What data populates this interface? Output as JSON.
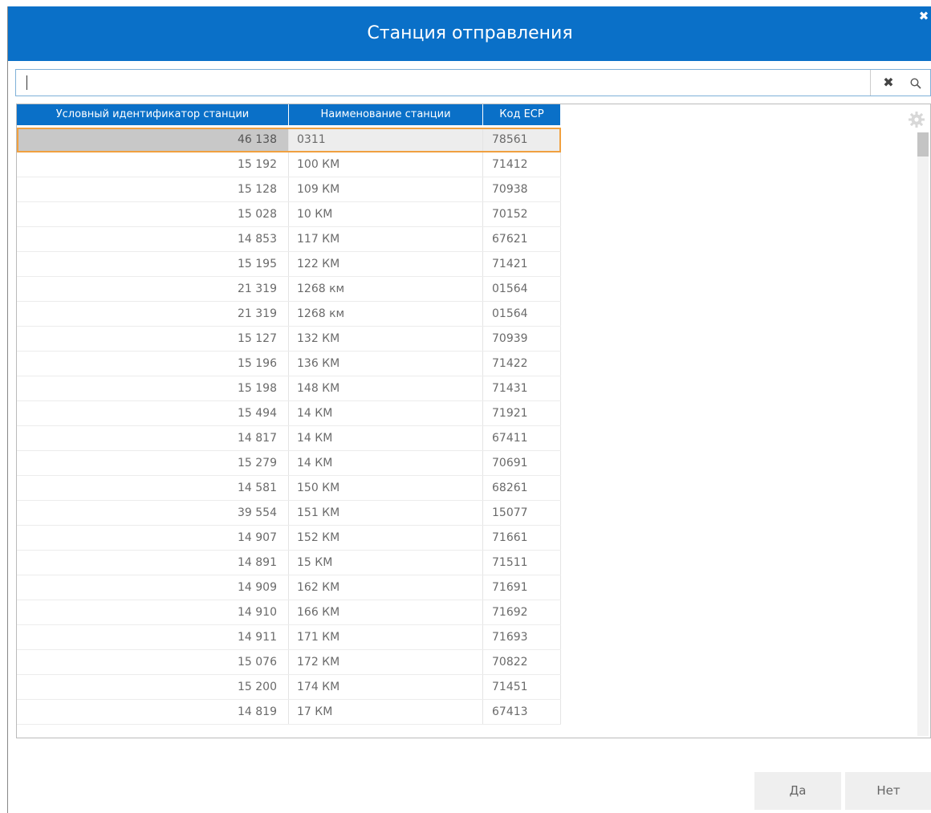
{
  "dialog": {
    "title": "Станция отправления"
  },
  "search": {
    "value": "",
    "placeholder": ""
  },
  "table": {
    "columns": [
      "Условный идентификатор станции",
      "Наименование станции",
      "Код ЕСР"
    ],
    "rows": [
      [
        "46 138",
        "0311",
        "78561"
      ],
      [
        "15 192",
        "100 КМ",
        "71412"
      ],
      [
        "15 128",
        "109 КМ",
        "70938"
      ],
      [
        "15 028",
        "10 КМ",
        "70152"
      ],
      [
        "14 853",
        "117 КМ",
        "67621"
      ],
      [
        "15 195",
        "122 КМ",
        "71421"
      ],
      [
        "21 319",
        "1268 км",
        "01564"
      ],
      [
        "21 319",
        "1268 км",
        "01564"
      ],
      [
        "15 127",
        "132 КМ",
        "70939"
      ],
      [
        "15 196",
        "136 КМ",
        "71422"
      ],
      [
        "15 198",
        "148 КМ",
        "71431"
      ],
      [
        "15 494",
        "14 КМ",
        "71921"
      ],
      [
        "14 817",
        "14 КМ",
        "67411"
      ],
      [
        "15 279",
        "14 КМ",
        "70691"
      ],
      [
        "14 581",
        "150 КМ",
        "68261"
      ],
      [
        "39 554",
        "151 КМ",
        "15077"
      ],
      [
        "14 907",
        "152 КМ",
        "71661"
      ],
      [
        "14 891",
        "15 КМ",
        "71511"
      ],
      [
        "14 909",
        "162 КМ",
        "71691"
      ],
      [
        "14 910",
        "166 КМ",
        "71692"
      ],
      [
        "14 911",
        "171 КМ",
        "71693"
      ],
      [
        "15 076",
        "172 КМ",
        "70822"
      ],
      [
        "15 200",
        "174 КМ",
        "71451"
      ],
      [
        "14 819",
        "17 КМ",
        "67413"
      ]
    ],
    "selected_row": 0
  },
  "buttons": {
    "yes": "Да",
    "no": "Нет"
  },
  "icons": {
    "close": "close-icon",
    "clear": "clear-icon",
    "search": "search-icon",
    "settings": "gear-icon"
  },
  "colors": {
    "accent": "#0a70c8",
    "selection_border": "#f0a040"
  }
}
